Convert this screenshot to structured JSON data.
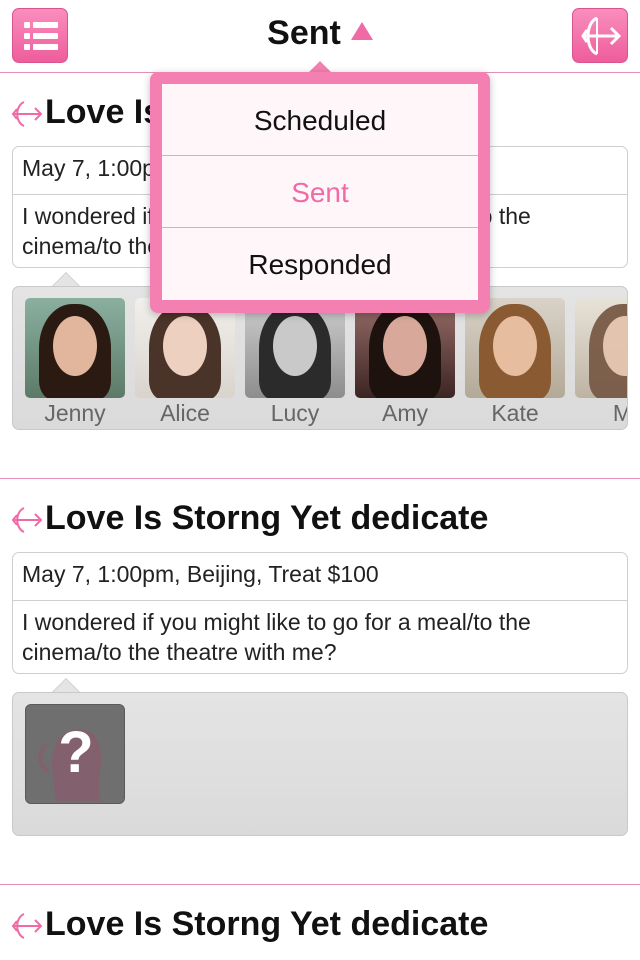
{
  "header": {
    "title": "Sent",
    "menu_icon": "list-icon",
    "right_icon": "cupid-arrow-icon"
  },
  "dropdown": {
    "items": [
      {
        "label": "Scheduled",
        "active": false
      },
      {
        "label": "Sent",
        "active": true
      },
      {
        "label": "Responded",
        "active": false
      }
    ]
  },
  "cards": [
    {
      "title": "Love Is Storng Yet dedicate",
      "details": "May 7, 1:00pm, Beijing, Treat $100",
      "message": "I wondered if you might like to go for a meal/to the cinema/to the theatre with me?",
      "people": [
        "Jenny",
        "Alice",
        "Lucy",
        "Amy",
        "Kate",
        "Mi"
      ]
    },
    {
      "title": "Love Is Storng Yet dedicate",
      "details": "May 7, 1:00pm, Beijing, Treat $100",
      "message": "I wondered if you might like to go for a meal/to the cinema/to the theatre with me?",
      "unknown_recipient": "?"
    },
    {
      "title": "Love Is Storng Yet dedicate"
    }
  ],
  "colors": {
    "accent": "#f06aa6",
    "button_pink": "#f47cb0",
    "divider": "#e98fb5"
  }
}
